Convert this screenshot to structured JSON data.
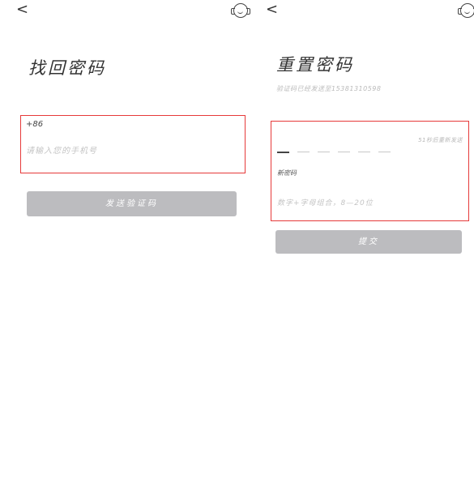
{
  "left": {
    "back_glyph": "<",
    "title": "找回密码",
    "country_code": "+86",
    "phone_placeholder": "请输入您的手机号",
    "send_button": "发送验证码",
    "help_icon": "customer-service-icon"
  },
  "right": {
    "back_glyph": "<",
    "title": "重置密码",
    "subtitle": "验证码已经发送至15381310598",
    "resend_text": "51秒后重新发送",
    "code_slots": 6,
    "new_password_label": "新密码",
    "password_placeholder": "数字+字母组合，8—20位",
    "submit_button": "提交",
    "help_icon": "customer-service-icon"
  },
  "colors": {
    "highlight": "#e63a3a",
    "button_bg": "#bcbcbf"
  }
}
